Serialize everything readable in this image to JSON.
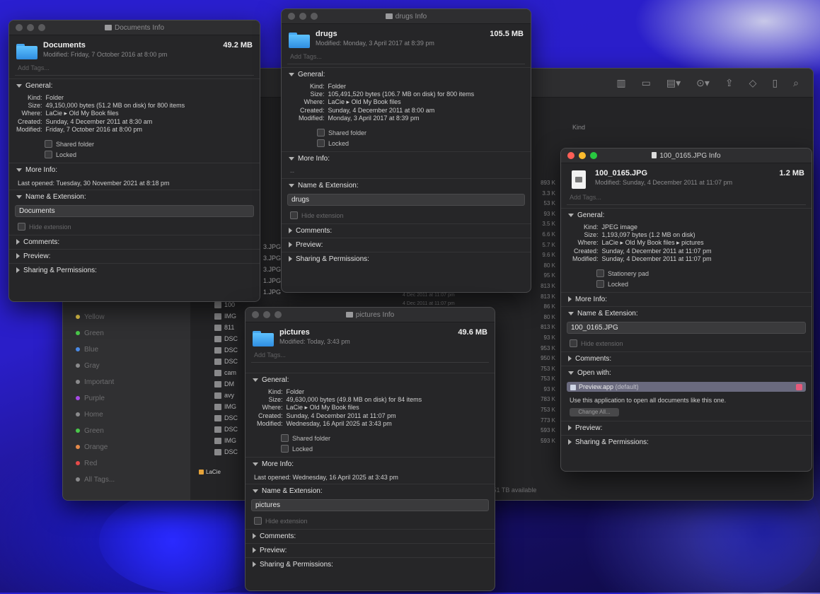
{
  "finder": {
    "toolbar_icons": [
      "columns-icon",
      "gallery-icon",
      "group-icon",
      "action-icon",
      "share-icon",
      "tag-icon",
      "trash-icon",
      "search-icon"
    ],
    "column_header": "Kind",
    "sidebar_tags": [
      {
        "label": "Yellow",
        "color": "#e6c84a"
      },
      {
        "label": "Green",
        "color": "#4ac84a"
      },
      {
        "label": "Blue",
        "color": "#4a8ae6"
      },
      {
        "label": "Gray",
        "color": "#8a8a8c"
      },
      {
        "label": "Important",
        "color": "#8a8a8c"
      },
      {
        "label": "Purple",
        "color": "#a64ae6"
      },
      {
        "label": "Home",
        "color": "#8a8a8c"
      },
      {
        "label": "Green",
        "color": "#4ac84a"
      },
      {
        "label": "Orange",
        "color": "#e68a4a"
      },
      {
        "label": "Red",
        "color": "#e64a4a"
      },
      {
        "label": "All Tags...",
        "color": "#8a8a8c"
      }
    ],
    "rows": [
      "3.JPG",
      "3.JPG",
      "3.JPG",
      "1.JPG",
      "1.JPG"
    ],
    "file_rows": [
      "100",
      "IMG",
      "811",
      "DSC",
      "DSC",
      "DSC",
      "cam",
      "DM",
      "avy",
      "IMG",
      "DSC",
      "DSC",
      "IMG",
      "DSC"
    ],
    "sizes": [
      "893 K",
      "3.3 K",
      "53 K",
      "93 K",
      "3.5 K",
      "6.6 K",
      "5.7 K",
      "9.6 K",
      "80 K",
      "95 K",
      "813 K",
      "813 K",
      "86 K",
      "80 K",
      "813 K",
      "93 K",
      "953 K",
      "950 K",
      "753 K",
      "753 K",
      "93 K",
      "783 K",
      "753 K",
      "773 K",
      "593 K",
      "593 K"
    ],
    "dates": [
      "4 Dec 2011 at 11:07 pm",
      "4 Dec 2011 at 11:07 pm"
    ],
    "path_item": "LaCie",
    "status": "2.51 TB available"
  },
  "documents": {
    "window_title": "Documents Info",
    "name": "Documents",
    "modified": "Modified: Friday, 7 October 2016 at 8:00 pm",
    "size": "49.2 MB",
    "tags_placeholder": "Add Tags...",
    "general_label": "General:",
    "kind": "Folder",
    "size_detail": "49,150,000 bytes (51.2 MB on disk) for 800 items",
    "where": "LaCie ▸ Old My Book files",
    "created": "Sunday, 4 December 2011 at 8:30 am",
    "modified_detail": "Friday, 7 October 2016 at 8:00 pm",
    "shared_label": "Shared folder",
    "locked_label": "Locked",
    "more_info_label": "More Info:",
    "last_opened": "Last opened: Tuesday, 30 November 2021 at 8:18 pm",
    "name_ext_label": "Name & Extension:",
    "name_value": "Documents",
    "hide_ext": "Hide extension",
    "comments_label": "Comments:",
    "preview_label": "Preview:",
    "sharing_label": "Sharing & Permissions:"
  },
  "drugs": {
    "window_title": "drugs Info",
    "name": "drugs",
    "modified": "Modified: Monday, 3 April 2017 at 8:39 pm",
    "size": "105.5 MB",
    "tags_placeholder": "Add Tags...",
    "general_label": "General:",
    "kind": "Folder",
    "size_detail": "105,491,520 bytes (106.7 MB on disk) for 800 items",
    "where": "LaCie ▸ Old My Book files",
    "created": "Sunday, 4 December 2011 at 8:00 am",
    "modified_detail": "Monday, 3 April 2017 at 8:39 pm",
    "shared_label": "Shared folder",
    "locked_label": "Locked",
    "more_info_label": "More Info:",
    "more_info_value": "--",
    "name_ext_label": "Name & Extension:",
    "name_value": "drugs",
    "hide_ext": "Hide extension",
    "comments_label": "Comments:",
    "preview_label": "Preview:",
    "sharing_label": "Sharing & Permissions:"
  },
  "jpg": {
    "window_title": "100_0165.JPG Info",
    "name": "100_0165.JPG",
    "modified": "Modified: Sunday, 4 December 2011 at 11:07 pm",
    "size": "1.2 MB",
    "tags_placeholder": "Add Tags...",
    "general_label": "General:",
    "kind": "JPEG image",
    "size_detail": "1,193,097 bytes (1.2 MB on disk)",
    "where": "LaCie ▸ Old My Book files ▸ pictures",
    "created": "Sunday, 4 December 2011 at 11:07 pm",
    "modified_detail": "Sunday, 4 December 2011 at 11:07 pm",
    "stationery_label": "Stationery pad",
    "locked_label": "Locked",
    "more_info_label": "More Info:",
    "name_ext_label": "Name & Extension:",
    "name_value": "100_0165.JPG",
    "hide_ext": "Hide extension",
    "comments_label": "Comments:",
    "open_with_label": "Open with:",
    "app_name": "Preview.app",
    "app_suffix": "(default)",
    "open_with_desc": "Use this application to open all documents like this one.",
    "change_all": "Change All...",
    "preview_label": "Preview:",
    "sharing_label": "Sharing & Permissions:"
  },
  "pictures": {
    "window_title": "pictures Info",
    "name": "pictures",
    "modified": "Modified: Today, 3:43 pm",
    "size": "49.6 MB",
    "tags_placeholder": "Add Tags...",
    "general_label": "General:",
    "kind": "Folder",
    "size_detail": "49,630,000 bytes (49.8 MB on disk) for 84 items",
    "where": "LaCie ▸ Old My Book files",
    "created": "Sunday, 4 December 2011 at 11:07 pm",
    "modified_detail": "Wednesday, 16 April 2025 at 3:43 pm",
    "shared_label": "Shared folder",
    "locked_label": "Locked",
    "more_info_label": "More Info:",
    "last_opened": "Last opened: Wednesday, 16 April 2025 at 3:43 pm",
    "name_ext_label": "Name & Extension:",
    "name_value": "pictures",
    "hide_ext": "Hide extension",
    "comments_label": "Comments:",
    "preview_label": "Preview:",
    "sharing_label": "Sharing & Permissions:"
  },
  "labels": {
    "kind": "Kind:",
    "size": "Size:",
    "where": "Where:",
    "created": "Created:",
    "modified": "Modified:"
  }
}
